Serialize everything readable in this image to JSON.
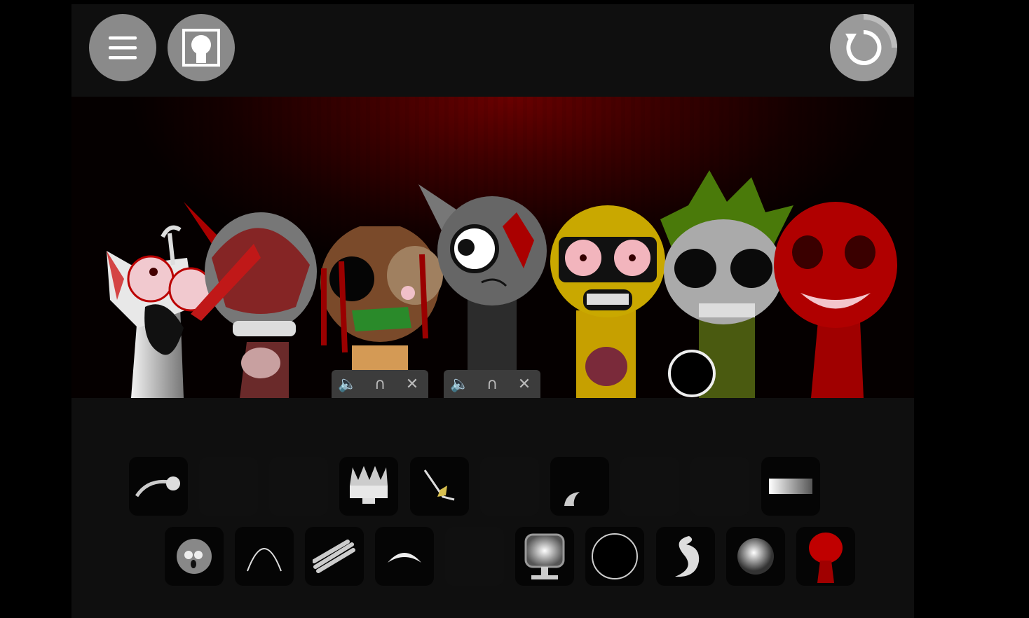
{
  "app": {
    "accent": "#8a8a8a",
    "stage_color": "#6a0000"
  },
  "topbar": {
    "menu_icon": "hamburger-menu-icon",
    "bonus_icon": "bonus-portrait-icon",
    "reset_icon": "reset-icon"
  },
  "stage": {
    "characters": [
      {
        "name": "character-1",
        "color": "#d9d9d9"
      },
      {
        "name": "character-2",
        "color": "#7a7a7a"
      },
      {
        "name": "character-3",
        "color": "#8a6a40"
      },
      {
        "name": "character-4",
        "color": "#555555"
      },
      {
        "name": "character-5",
        "color": "#d7b400"
      },
      {
        "name": "character-6",
        "color": "#5f7a12"
      },
      {
        "name": "character-7",
        "color": "#b00000"
      }
    ],
    "control_panels": [
      {
        "icons": [
          "mute-icon",
          "solo-headphones-icon",
          "close-icon"
        ]
      },
      {
        "icons": [
          "mute-icon",
          "solo-headphones-icon",
          "close-icon"
        ]
      }
    ]
  },
  "palette": {
    "row1": [
      "sound-hook-icon",
      "empty",
      "empty",
      "sound-crown-icon",
      "sound-spark-icon",
      "empty",
      "sound-claw-icon",
      "empty",
      "empty",
      "sound-bar-icon"
    ],
    "row2": [
      "sound-face-icon",
      "sound-arc-icon",
      "sound-stripes-icon",
      "sound-chevron-icon",
      "empty",
      "sound-monitor-icon",
      "sound-ring-icon",
      "sound-swirl-icon",
      "sound-orb-icon",
      "sound-bloodmic-icon"
    ]
  }
}
